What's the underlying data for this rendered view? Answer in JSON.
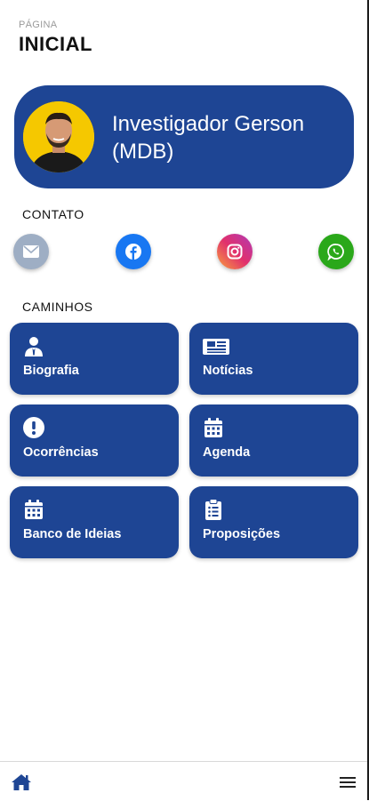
{
  "header": {
    "subtitle": "PÁGINA",
    "title": "INICIAL"
  },
  "profile": {
    "name": "Investigador Gerson (MDB)",
    "avatar_color": "#f5c800"
  },
  "contact": {
    "label": "CONTATO",
    "items": [
      {
        "icon": "mail-icon",
        "color": "#9eaec4"
      },
      {
        "icon": "facebook-icon",
        "color": "#1877f2"
      },
      {
        "icon": "instagram-icon",
        "color": "#e1306c"
      },
      {
        "icon": "whatsapp-icon",
        "color": "#2aa81a"
      }
    ]
  },
  "paths": {
    "label": "CAMINHOS",
    "tiles": [
      {
        "label": "Biografia",
        "icon": "user-tie-icon"
      },
      {
        "label": "Notícias",
        "icon": "newspaper-icon"
      },
      {
        "label": "Ocorrências",
        "icon": "exclamation-circle-icon"
      },
      {
        "label": "Agenda",
        "icon": "calendar-icon"
      },
      {
        "label": "Banco de Ideias",
        "icon": "calendar-icon"
      },
      {
        "label": "Proposições",
        "icon": "clipboard-list-icon"
      }
    ]
  },
  "colors": {
    "primary": "#1e4594"
  },
  "bottom_nav": {
    "home_icon": "home-icon",
    "menu_icon": "menu-icon"
  }
}
